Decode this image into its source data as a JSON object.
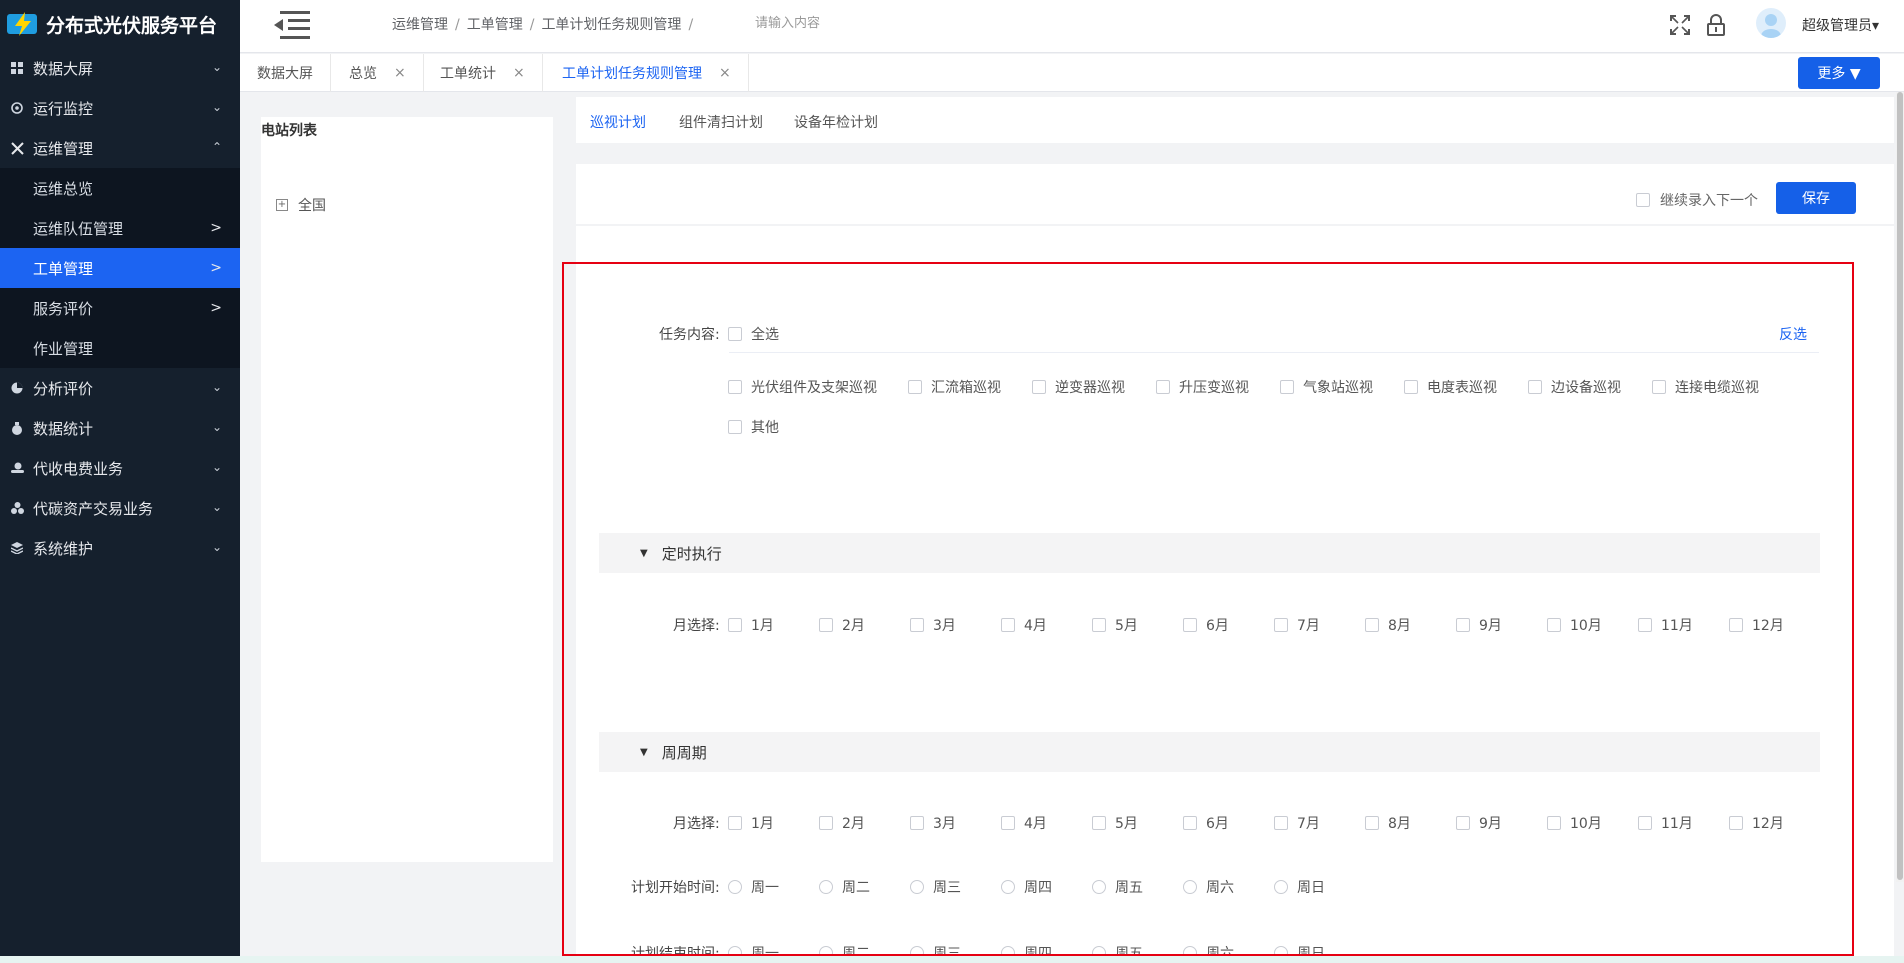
{
  "app": {
    "title": "分布式光伏服务平台"
  },
  "colors": {
    "accent": "#1c64f2",
    "sidebar_bg": "#15202d",
    "highlight_box": "#e60012"
  },
  "sidebar": {
    "items": [
      {
        "label": "数据大屏",
        "icon": "grid-icon",
        "arrow": "⌄"
      },
      {
        "label": "运行监控",
        "icon": "monitor-icon",
        "arrow": "⌄"
      },
      {
        "label": "运维管理",
        "icon": "tools-icon",
        "arrow": "⌃"
      },
      {
        "label": "分析评价",
        "icon": "pie-chart-icon",
        "arrow": "⌄"
      },
      {
        "label": "数据统计",
        "icon": "money-bag-icon",
        "arrow": "⌄"
      },
      {
        "label": "代收电费业务",
        "icon": "hand-coin-icon",
        "arrow": "⌄"
      },
      {
        "label": "代碳资产交易业务",
        "icon": "molecule-icon",
        "arrow": "⌄"
      },
      {
        "label": "系统维护",
        "icon": "layers-icon",
        "arrow": "⌄"
      }
    ],
    "submenu": [
      {
        "label": "运维总览",
        "arrow": ""
      },
      {
        "label": "运维队伍管理",
        "arrow": ">"
      },
      {
        "label": "工单管理",
        "arrow": ">"
      },
      {
        "label": "服务评价",
        "arrow": ">"
      },
      {
        "label": "作业管理",
        "arrow": ""
      }
    ]
  },
  "header": {
    "breadcrumb": [
      "运维管理",
      "工单管理",
      "工单计划任务规则管理"
    ],
    "breadcrumb_sep": "/",
    "search_placeholder": "请输入内容",
    "user": "超级管理员▾"
  },
  "tabs": {
    "items": [
      "数据大屏",
      "总览",
      "工单统计",
      "工单计划任务规则管理"
    ],
    "close": "×",
    "more": "更多 ▼"
  },
  "station": {
    "title": "电站列表",
    "tree_root": "全国",
    "plus": "+"
  },
  "subtabs": [
    "巡视计划",
    "组件清扫计划",
    "设备年检计划"
  ],
  "savebar": {
    "continue_label": "继续录入下一个",
    "save_label": "保存"
  },
  "form": {
    "task_label": "任务内容:",
    "select_all": "全选",
    "invert": "反选",
    "tasks": [
      "光伏组件及支架巡视",
      "汇流箱巡视",
      "逆变器巡视",
      "升压变巡视",
      "气象站巡视",
      "电度表巡视",
      "边设备巡视",
      "连接电缆巡视",
      "其他"
    ],
    "section_timed": "定时执行",
    "section_weekly": "周周期",
    "section_toggle": "▼",
    "month_label": "月选择:",
    "months": [
      "1月",
      "2月",
      "3月",
      "4月",
      "5月",
      "6月",
      "7月",
      "8月",
      "9月",
      "10月",
      "11月",
      "12月"
    ],
    "start_label": "计划开始时间:",
    "end_label": "计划结束时间:",
    "weekdays": [
      "周一",
      "周二",
      "周三",
      "周四",
      "周五",
      "周六",
      "周日"
    ]
  }
}
